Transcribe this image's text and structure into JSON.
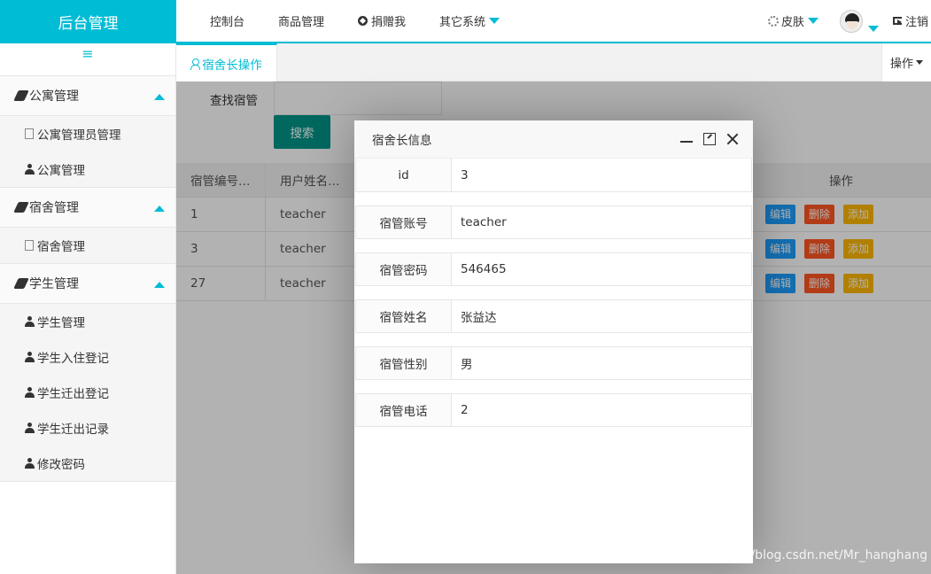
{
  "header": {
    "logo": "后台管理",
    "nav": [
      {
        "label": "控制台"
      },
      {
        "label": "商品管理"
      },
      {
        "label": "捐赠我"
      },
      {
        "label": "其它系统"
      }
    ],
    "skin": "皮肤",
    "logout": "注销",
    "accent_color": "#00bcd4"
  },
  "sidebar": {
    "groups": [
      {
        "title": "公寓管理",
        "items": [
          "公寓管理员管理",
          "公寓管理"
        ]
      },
      {
        "title": "宿舍管理",
        "items": [
          "宿舍管理"
        ]
      },
      {
        "title": "学生管理",
        "items": [
          "学生管理",
          "学生入住登记",
          "学生迁出登记",
          "学生迁出记录",
          "修改密码"
        ]
      }
    ]
  },
  "tabs": {
    "active": "宿舍长操作",
    "ops": "操作"
  },
  "search": {
    "label": "查找宿管",
    "value": "",
    "button": "搜索"
  },
  "table": {
    "headers": [
      "宿管编号…",
      "用户姓名…",
      "",
      "操作"
    ],
    "rows": [
      {
        "id": "1",
        "name": "teacher"
      },
      {
        "id": "3",
        "name": "teacher"
      },
      {
        "id": "27",
        "name": "teacher"
      }
    ],
    "actions": {
      "edit": "编辑",
      "delete": "删除",
      "add": "添加"
    }
  },
  "modal": {
    "title": "宿舍长信息",
    "fields": [
      {
        "label": "id",
        "value": "3"
      },
      {
        "label": "宿管账号",
        "value": "teacher"
      },
      {
        "label": "宿管密码",
        "value": "546465"
      },
      {
        "label": "宿管姓名",
        "value": "张益达"
      },
      {
        "label": "宿管性别",
        "value": "男"
      },
      {
        "label": "宿管电话",
        "value": "2"
      }
    ]
  },
  "watermark": "https://blog.csdn.net/Mr_hanghang"
}
